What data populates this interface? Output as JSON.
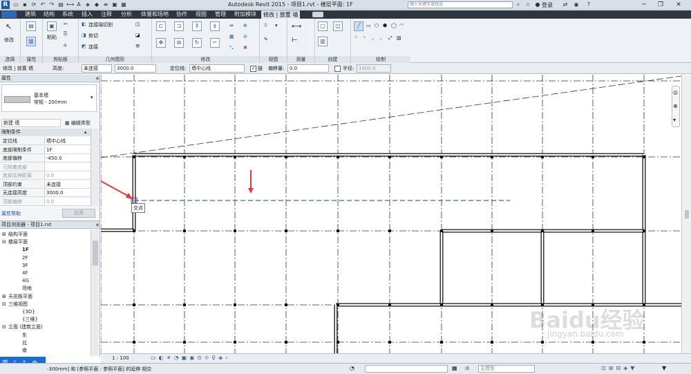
{
  "titlebar": {
    "app_title": "Autodesk Revit 2015 -     项目1.rvt - 楼层平面: 1F",
    "search_placeholder": "键入关键字或短语",
    "signin": "登录",
    "help": "?"
  },
  "tabs": [
    "建筑",
    "结构",
    "系统",
    "插入",
    "注释",
    "分析",
    "体量和场地",
    "协作",
    "视图",
    "管理",
    "附加模块",
    "修改 | 放置 墙"
  ],
  "ribbon": {
    "panels": [
      "选择",
      "属性",
      "剪贴板",
      "几何图形",
      "修改",
      "视图",
      "测量",
      "创建",
      "绘制"
    ],
    "modify_label": "修改",
    "paste_label": "粘贴",
    "cut_geom": "连接端切割",
    "cut": "剪切",
    "join": "连接"
  },
  "options": {
    "context": "修改 | 放置 墙",
    "height_label": "高度:",
    "height_mode": "未连接",
    "height_value": "3000.0",
    "locline_label": "定位线:",
    "locline_value": "墙中心线",
    "chain_label": "链",
    "offset_label": "偏移量:",
    "offset_value": "0.0",
    "radius_label": "半径:",
    "radius_value": "1000.0"
  },
  "properties": {
    "title": "属性",
    "type_name": "基本墙",
    "type_sub": "常规 - 200mm",
    "instance": "新建 墙",
    "edit_type": "编辑类型",
    "section": "限制条件",
    "rows": [
      {
        "k": "定位线",
        "v": "墙中心线"
      },
      {
        "k": "底部限制条件",
        "v": "1F"
      },
      {
        "k": "底部偏移",
        "v": "-450.0"
      },
      {
        "k": "已附着底部",
        "v": ""
      },
      {
        "k": "底部延伸距离",
        "v": "0.0"
      },
      {
        "k": "顶部约束",
        "v": "未连接"
      },
      {
        "k": "无连接高度",
        "v": "3000.0"
      },
      {
        "k": "顶部偏移",
        "v": "0.0"
      }
    ],
    "help": "属性帮助",
    "apply": "应用"
  },
  "browser": {
    "title": "项目浏览器 - 项目1.rvt",
    "nodes": [
      "结构平面",
      "楼层平面",
      "1F",
      "2F",
      "3F",
      "4F",
      "4G",
      "场地",
      "天花板平面",
      "三维视图",
      "{3D}",
      "{三维}",
      "立面 (建筑立面)",
      "东",
      "北",
      "南"
    ]
  },
  "canvas": {
    "snap_label": "交点"
  },
  "viewbar": {
    "scale": "1 : 100"
  },
  "status": {
    "text": "-300mm] 和 [参照平面 : 参照平面] 的延伸 相交",
    "model": "主模型",
    "zero": ":0"
  },
  "ime": {
    "text": "英"
  },
  "watermark": {
    "brand": "Baidu经验",
    "url": "jingyan.baidu.com"
  },
  "colors": {
    "accent": "#1b5aa6",
    "arrow": "#e03a3a",
    "refline": "#2f6fb8"
  }
}
